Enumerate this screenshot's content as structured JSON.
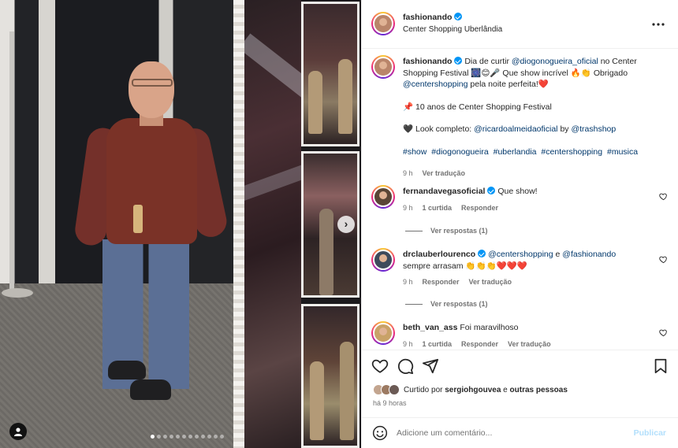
{
  "post": {
    "username": "fashionando",
    "location": "Center Shopping Uberlândia",
    "more_icon": "more-horizontal-icon"
  },
  "caption": {
    "username": "fashionando",
    "text_1": "Dia de curtir",
    "mention_1": "@diogonogueira_oficial",
    "text_2": "no Center Shopping Festival",
    "emoji_1": "🎆😊🎤",
    "text_3": "Que show incrível",
    "emoji_2": "🔥👏",
    "text_4": "Obrigado",
    "mention_2": "@centershopping",
    "text_5": "pela noite perfeita!",
    "emoji_3": "❤️",
    "line_2_emoji": "📌",
    "line_2": "10 anos de Center Shopping Festival",
    "line_3_emoji": "🖤",
    "line_3_prefix": "Look completo:",
    "mention_3": "@ricardoalmeidaoficial",
    "line_3_by": "by",
    "mention_4": "@trashshop",
    "hashtags": [
      "#show",
      "#diogonogueira",
      "#uberlandia",
      "#centershopping",
      "#musica"
    ],
    "time": "9 h",
    "translate": "Ver tradução"
  },
  "comments": [
    {
      "username": "fernandavegasoficial",
      "verified": true,
      "text": "Que show!",
      "time": "9 h",
      "likes": "1 curtida",
      "reply": "Responder",
      "view_replies": "Ver respostas (1)"
    },
    {
      "username": "drclauberlourenco",
      "verified": true,
      "mention_1": "@centershopping",
      "connector": "e",
      "mention_2": "@fashionando",
      "text": "sempre arrasam",
      "emoji": "👏👏👏❤️❤️❤️",
      "time": "9 h",
      "reply": "Responder",
      "translate": "Ver tradução",
      "view_replies": "Ver respostas (1)"
    },
    {
      "username": "beth_van_ass",
      "verified": false,
      "text": "Foi maravilhoso",
      "time": "9 h",
      "likes": "1 curtida",
      "reply": "Responder",
      "translate": "Ver tradução"
    }
  ],
  "actions": {
    "like_icon": "heart-icon",
    "comment_icon": "comment-icon",
    "share_icon": "send-icon",
    "save_icon": "bookmark-icon",
    "liked_by_prefix": "Curtido por",
    "liked_by_user": "sergiohgouvea",
    "liked_by_suffix": "e",
    "liked_by_others": "outras pessoas",
    "posted_ago": "há 9 horas"
  },
  "add_comment": {
    "placeholder": "Adicione um comentário...",
    "publish_label": "Publicar"
  },
  "carousel": {
    "slides": 12,
    "current_slide": 1,
    "next_icon": "chevron-right-icon",
    "next_glyph": "›",
    "tag_icon": "user-tag-icon"
  },
  "colors": {
    "link": "#00376b",
    "verified": "#0095f6",
    "publish_disabled": "#b2dffc",
    "secondary_text": "#737373"
  }
}
